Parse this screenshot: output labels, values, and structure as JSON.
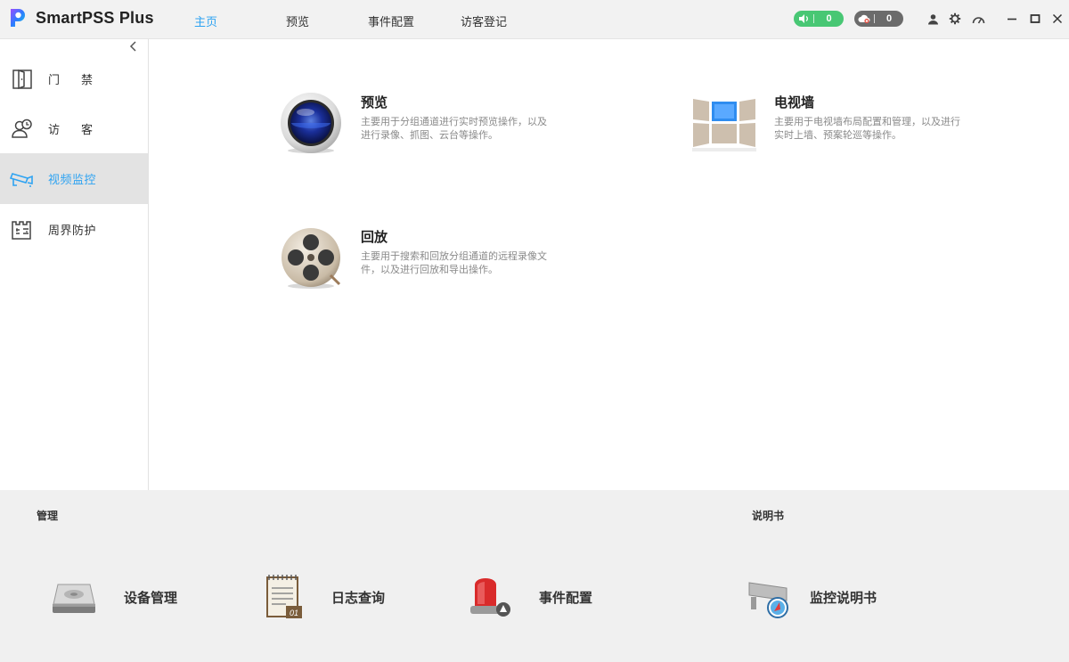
{
  "app": {
    "title": "SmartPSS Plus"
  },
  "nav": {
    "tabs": [
      {
        "label": "主页",
        "active": true
      },
      {
        "label": "预览",
        "active": false
      },
      {
        "label": "事件配置",
        "active": false
      },
      {
        "label": "访客登记",
        "active": false
      }
    ]
  },
  "status": {
    "alarm_count": "0",
    "alarm_color": "#48c774",
    "offline_count": "0",
    "offline_color": "#6b6b6b"
  },
  "toolbar_icons": [
    "user-icon",
    "settings-icon",
    "performance-icon",
    "minimize-icon",
    "maximize-icon",
    "close-icon"
  ],
  "sidebar": {
    "items": [
      {
        "label": "门禁",
        "icon": "door-icon",
        "active": false
      },
      {
        "label": "访客",
        "icon": "visitor-icon",
        "active": false
      },
      {
        "label": "视频监控",
        "icon": "camera-icon",
        "active": true
      },
      {
        "label": "周界防护",
        "icon": "perimeter-icon",
        "active": false
      }
    ],
    "accent_color": "#2ea3f2"
  },
  "main": {
    "cards": [
      {
        "title": "预览",
        "desc": "主要用于分组通道进行实时预览操作，以及进行录像、抓图、云台等操作。",
        "icon": "preview-lens-icon"
      },
      {
        "title": "电视墙",
        "desc": "主要用于电视墙布局配置和管理，以及进行实时上墙、预案轮巡等操作。",
        "icon": "video-wall-icon"
      },
      {
        "title": "回放",
        "desc": "主要用于搜索和回放分组通道的远程录像文件，以及进行回放和导出操作。",
        "icon": "film-reel-icon"
      }
    ]
  },
  "bottom": {
    "manage_label": "管理",
    "manual_label": "说明书",
    "tools": [
      {
        "label": "设备管理",
        "icon": "device-icon"
      },
      {
        "label": "日志查询",
        "icon": "log-icon"
      },
      {
        "label": "事件配置",
        "icon": "alarm-light-icon"
      },
      {
        "label": "监控说明书",
        "icon": "camera-manual-icon"
      }
    ]
  }
}
